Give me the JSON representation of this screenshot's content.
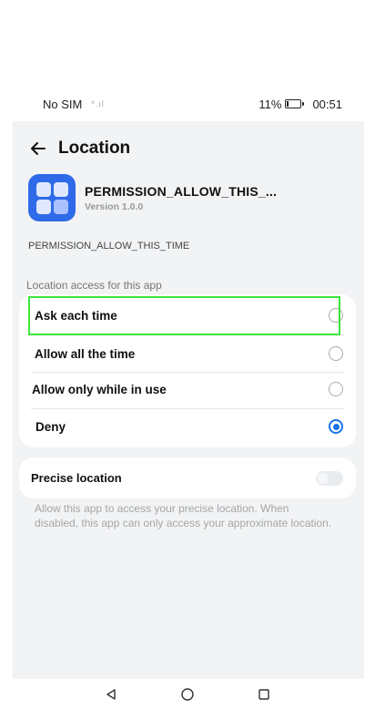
{
  "status_bar": {
    "carrier": "No SIM",
    "signal_icon": "signal-bars-icon",
    "battery_percent": "11%",
    "time": "00:51"
  },
  "header": {
    "title": "Location",
    "back_icon": "arrow-left-icon"
  },
  "app": {
    "name": "PERMISSION_ALLOW_THIS_...",
    "version": "Version 1.0.0",
    "icon": "app-grid-icon",
    "icon_color": "#2f6be8"
  },
  "permission_description": "PERMISSION_ALLOW_THIS_TIME",
  "section_label": "Location access for this app",
  "options": [
    {
      "label": "Ask each time",
      "selected": false
    },
    {
      "label": "Allow all the time",
      "selected": false
    },
    {
      "label": "Allow only while in use",
      "selected": false
    },
    {
      "label": "Deny",
      "selected": true
    }
  ],
  "precise": {
    "label": "Precise location",
    "enabled": false,
    "hint": "Allow this app to access your precise location. When disabled, this app can only access your approximate location."
  },
  "colors": {
    "accent": "#1a73e8",
    "highlight": "#3ce43c",
    "background": "#f1f3f5"
  },
  "nav": {
    "back_icon": "triangle-back-icon",
    "home_icon": "circle-home-icon",
    "recents_icon": "square-recents-icon"
  }
}
